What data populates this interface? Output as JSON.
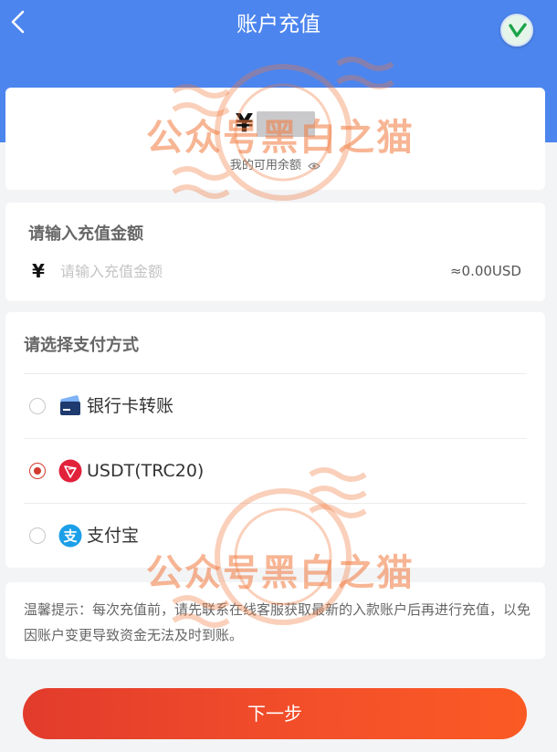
{
  "header": {
    "title": "账户充值"
  },
  "balance": {
    "currency_symbol": "¥",
    "label": "我的可用余额"
  },
  "recharge": {
    "title": "请输入充值金额",
    "currency_symbol": "¥",
    "placeholder": "请输入充值金额",
    "usd_estimate": "≈0.00USD"
  },
  "payment": {
    "title": "请选择支付方式",
    "options": [
      {
        "label": "银行卡转账",
        "icon": "bank-card-icon",
        "selected": false
      },
      {
        "label": "USDT(TRC20)",
        "icon": "tron-icon",
        "selected": true
      },
      {
        "label": "支付宝",
        "icon": "alipay-icon",
        "selected": false
      }
    ]
  },
  "tip": {
    "text": "温馨提示：每次充值前，请先联系在线客服获取最新的入款账户后再进行充值，以免因账户变更导致资金无法及时到账。"
  },
  "actions": {
    "next_label": "下一步"
  },
  "watermark": {
    "text": "公众号黑白之猫"
  },
  "colors": {
    "header": "#4c85ee",
    "accent": "#d23a2e",
    "button_start": "#e23b2c",
    "button_end": "#fb5a24"
  }
}
